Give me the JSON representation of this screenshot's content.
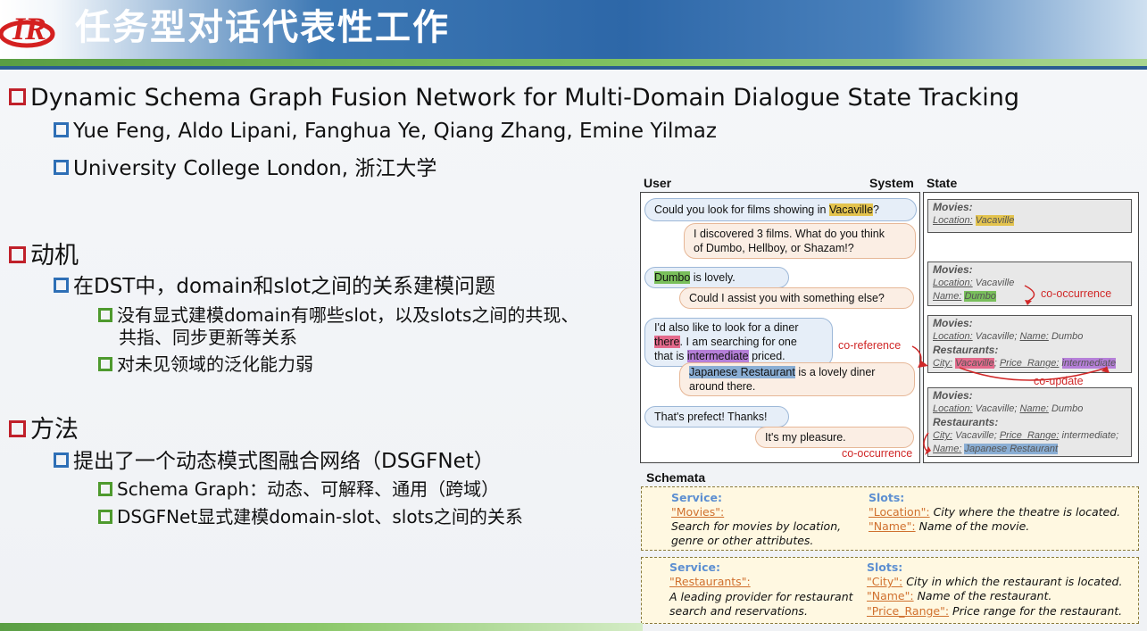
{
  "header": {
    "title": "任务型对话代表性工作",
    "logo_text": "IR"
  },
  "paper": {
    "title": "Dynamic Schema Graph Fusion Network for Multi-Domain Dialogue State Tracking",
    "authors": "Yue Feng, Aldo Lipani, Fanghua Ye, Qiang Zhang, Emine Yilmaz",
    "affiliation": "University College London, 浙江大学"
  },
  "motivation": {
    "heading": "动机",
    "point": "在DST中，domain和slot之间的关系建模问题",
    "sub1_line1": "没有显式建模domain有哪些slot，以及slots之间的共现、",
    "sub1_line2": "共指、同步更新等关系",
    "sub2": "对未见领域的泛化能力弱"
  },
  "method": {
    "heading": "方法",
    "point": "提出了一个动态模式图融合网络（DSGFNet）",
    "sub1": "Schema Graph：动态、可解释、通用（跨域）",
    "sub2": "DSGFNet显式建模domain-slot、slots之间的关系"
  },
  "figure": {
    "col_user": "User",
    "col_system": "System",
    "col_state": "State",
    "dialogue": {
      "u1_a": "Could you look for films showing in ",
      "u1_hl": "Vacaville",
      "u1_b": "?",
      "s1_l1": "I discovered 3 films. What do you think",
      "s1_l2": "of Dumbo, Hellboy, or Shazam!?",
      "u2_hl": "Dumbo",
      "u2_b": " is lovely.",
      "s2": "Could I assist you with something else?",
      "u3_l1": "I'd also like to look for a diner",
      "u3_l2_hl": "there",
      "u3_l2_b": ". I am searching for one",
      "u3_l3_a": "that is ",
      "u3_l3_hl": "intermediate",
      "u3_l3_b": " priced.",
      "s3_l1_hl": "Japanese Restaurant",
      "s3_l1_b": " is a lovely diner",
      "s3_l2": "around there.",
      "u4": "That's prefect! Thanks!",
      "s4": "It's my pleasure."
    },
    "states": {
      "movies": "Movies:",
      "restaurants": "Restaurants:",
      "location": "Location:",
      "name": "Name:",
      "city": "City:",
      "price_range": "Price_Range:",
      "v_vacaville": "Vacaville",
      "v_dumbo": "Dumbo",
      "v_intermediate": "intermediate",
      "v_japanese": "Japanese Restaurant"
    },
    "annotations": {
      "co_occurrence": "co-occurrence",
      "co_reference": "co-reference",
      "co_update": "co-update"
    },
    "schemata": {
      "title": "Schemata",
      "service_label": "Service:",
      "slots_label": "Slots:",
      "s1_service": "\"Movies\":",
      "s1_desc_l1": "Search for movies by location,",
      "s1_desc_l2": "genre or other attributes.",
      "s1_slot1_name": "\"Location\":",
      "s1_slot1_desc": " City where the theatre is located.",
      "s1_slot2_name": "\"Name\":",
      "s1_slot2_desc": " Name of the movie.",
      "s2_service": "\"Restaurants\":",
      "s2_desc_l1": "A leading provider for restaurant",
      "s2_desc_l2": "search and reservations.",
      "s2_slot1_name": "\"City\":",
      "s2_slot1_desc": " City in which the restaurant is located.",
      "s2_slot2_name": "\"Name\":",
      "s2_slot2_desc": " Name of the restaurant.",
      "s2_slot3_name": "\"Price_Range\":",
      "s2_slot3_desc": " Price range for the restaurant."
    }
  },
  "colors": {
    "header_blue": "#2d67a8",
    "bullet_red": "#c0202a",
    "bullet_blue": "#2e6fb6",
    "bullet_green": "#4e9a2e",
    "annotation_red": "#d02828"
  }
}
